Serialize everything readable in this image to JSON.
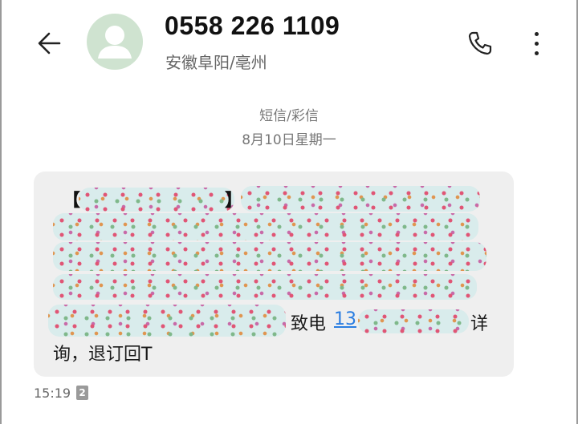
{
  "header": {
    "contact_number": "0558 226 1109",
    "contact_location": "安徽阜阳/亳州",
    "back_icon": "arrow-left-icon",
    "call_icon": "phone-icon",
    "more_icon": "more-vertical-icon",
    "avatar_icon": "person-avatar-icon"
  },
  "conversation": {
    "message_type": "短信/彩信",
    "date": "8月10日星期一"
  },
  "message": {
    "bracket_open": "【",
    "bracket_close": "】",
    "call_prefix": "致电",
    "phone_partial": "13",
    "suffix_char": "详",
    "last_line": "询，退订回T",
    "time": "15:19",
    "sim_slot": "2"
  },
  "colors": {
    "bubble_bg": "#efefef",
    "link": "#2a7de1",
    "avatar_bg": "#cfe3d0"
  }
}
